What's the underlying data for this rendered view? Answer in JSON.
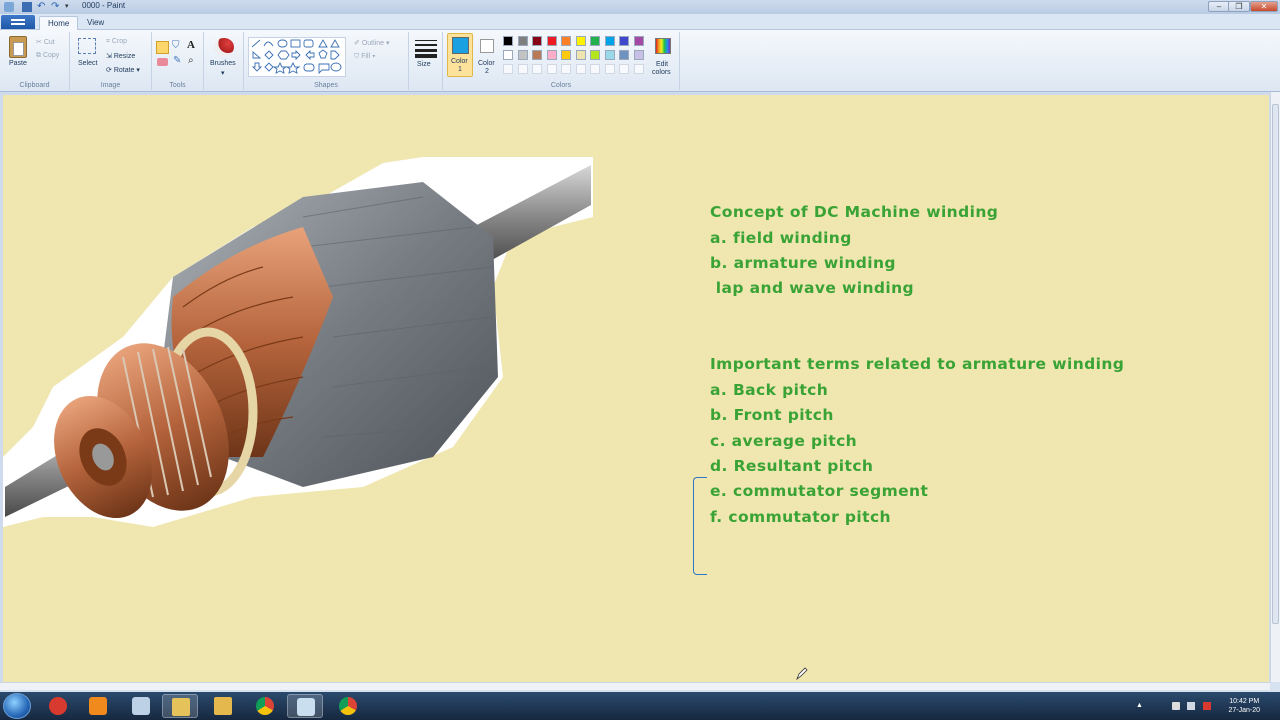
{
  "window": {
    "title": "0000 - Paint"
  },
  "tabs": {
    "file": "",
    "home": "Home",
    "view": "View"
  },
  "ribbon": {
    "clipboard": {
      "paste": "Paste",
      "cut": "Cut",
      "copy": "Copy",
      "label": "Clipboard"
    },
    "image": {
      "select": "Select",
      "crop": "Crop",
      "resize": "Resize",
      "rotate": "Rotate",
      "label": "Image"
    },
    "tools": {
      "label": "Tools"
    },
    "brushes": {
      "label": "Brushes"
    },
    "shapes": {
      "outline": "Outline",
      "fill": "Fill",
      "label": "Shapes"
    },
    "size": {
      "label": "Size"
    },
    "color1": {
      "label_line1": "Color",
      "label_line2": "1"
    },
    "color2": {
      "label_line1": "Color",
      "label_line2": "2"
    },
    "colors": {
      "label": "Colors"
    },
    "edit_colors": {
      "label_line1": "Edit",
      "label_line2": "colors"
    }
  },
  "palette": {
    "color1": "#1ba1e2",
    "color2": "#ffffff",
    "row1": [
      "#000000",
      "#7f7f7f",
      "#880015",
      "#ed1c24",
      "#ff7f27",
      "#fff200",
      "#22b14c",
      "#00a2e8",
      "#3f48cc",
      "#a349a4"
    ],
    "row2": [
      "#ffffff",
      "#c3c3c3",
      "#b97a57",
      "#ffaec9",
      "#ffc90e",
      "#efe4b0",
      "#b5e61d",
      "#99d9ea",
      "#7092be",
      "#c8bfe7"
    ]
  },
  "canvas": {
    "background": "#f0e6b0",
    "text_color": "#3aa335",
    "lines": [
      "Concept of DC Machine winding",
      "a. field winding",
      "b. armature winding",
      " lap and wave winding",
      "Important terms related to armature winding",
      "a. Back pitch",
      "b. Front pitch",
      "c. average pitch",
      "d. Resultant pitch",
      "e. commutator segment",
      "f. commutator pitch"
    ]
  },
  "taskbar": {
    "time": "10:42 PM",
    "date": "27-Jan-20",
    "apps": [
      "start-orb",
      "paint-app",
      "media-player",
      "file-explorer",
      "folder",
      "tools",
      "chrome",
      "paint-active",
      "chrome-2"
    ]
  }
}
